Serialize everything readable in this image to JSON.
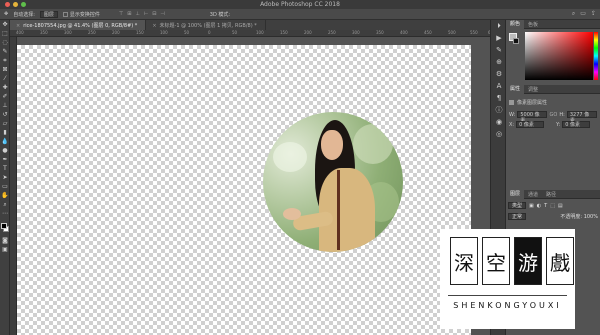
{
  "window": {
    "title": "Adobe Photoshop CC 2018"
  },
  "options_bar": {
    "auto_select_label": "自动选择:",
    "auto_select_value": "图层",
    "transform_label": "显示变换控件",
    "mode_3d": "3D 模式:"
  },
  "tabs": [
    {
      "label": "rice-1807554.jpg @ 41.4% (图层 0, RGB/8#) *"
    },
    {
      "label": "未标题-1 @ 100% (图层 1 拷贝, RGB/8) *"
    }
  ],
  "ruler_marks": [
    "400",
    "350",
    "300",
    "250",
    "200",
    "150",
    "100",
    "50",
    "0",
    "50",
    "100",
    "150",
    "200",
    "250",
    "300",
    "350",
    "400",
    "450",
    "500",
    "550",
    "600"
  ],
  "right_panel": {
    "color_tabs": [
      "颜色",
      "色板"
    ],
    "props_tabs": [
      "属性",
      "调整"
    ],
    "props_title": "像素图层属性",
    "w_label": "W:",
    "w_value": "5000 像素",
    "link_icon_text": "GO",
    "h_label": "H:",
    "h_value": "3277 像素",
    "x_label": "X:",
    "x_value": "0 像素",
    "y_label": "Y:",
    "y_value": "0 像素",
    "layers_tabs": [
      "图层",
      "通道",
      "路径"
    ],
    "kind_filter": "类型",
    "blend_mode": "正常",
    "opacity_label": "不透明度: 100%"
  },
  "watermark": {
    "chars": [
      "深",
      "空",
      "游",
      "戲"
    ],
    "pinyin": "SHENKONGYOUXI"
  }
}
